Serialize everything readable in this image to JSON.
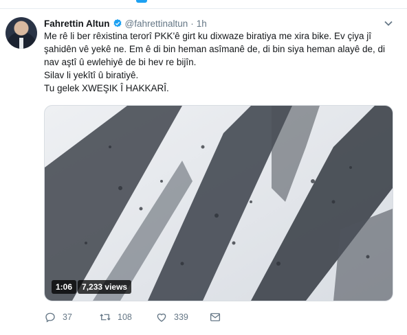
{
  "tweet": {
    "author_name": "Fahrettin Altun",
    "handle": "@fahrettinaltun",
    "dot": "·",
    "time": "1h",
    "text_lines": [
      "Me rê li ber rêxistina terorî PKK'ê girt ku dixwaze biratiya me xira bike. Ev çiya jî şahidên vê yekê ne. Em ê di bin heman asîmanê de, di bin siya heman alayê de, di nav aştî û ewlehiyê de bi hev re bijîn.",
      "Silav li yekîtî û biratiyê.",
      "Tu gelek XWEŞIK Î HAKKARÎ."
    ],
    "video": {
      "duration": "1:06",
      "views": "7,233 views"
    },
    "actions": {
      "replies": "37",
      "retweets": "108",
      "likes": "339"
    }
  },
  "colors": {
    "accent": "#1da1f2",
    "text": "#14171a",
    "muted": "#657786"
  },
  "icons": [
    "verified-badge-icon",
    "chevron-down-icon",
    "reply-icon",
    "retweet-icon",
    "like-icon",
    "message-icon"
  ]
}
